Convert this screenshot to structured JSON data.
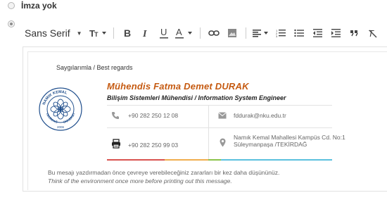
{
  "options": {
    "none_label": "İmza yok"
  },
  "toolbar": {
    "font_family": "Sans Serif"
  },
  "signature": {
    "greeting": "Saygılarımla / Best regards",
    "name": "Mühendis Fatma Demet DURAK",
    "title": "Bilişim Sistemleri Mühendisi / Information System Engineer",
    "phone": "+90 282 250 12 08",
    "fax": "+90 282 250 99 03",
    "email": "fddurak@nku.edu.tr",
    "address_line1": "Namık Kemal Mahallesi Kampüs Cd. No:1",
    "address_line2": "Süleymanpaşa /TEKİRDAĞ",
    "note_tr": "Bu mesajı yazdırmadan önce çevreye verebileceğiniz zararları bir kez daha düşününüz.",
    "note_en": "Think of the environment once more before printing out this message.",
    "logo_text_top": "NAMIK KEMAL",
    "logo_text_left": "TEKİRDAĞ",
    "logo_text_right": "ÜNİVERSİTESİ",
    "logo_year": "2006"
  },
  "colors": {
    "name_color": "#c55a11",
    "bar_red": "#d9534f",
    "bar_orange": "#f0ad4e",
    "bar_green": "#8bc34a",
    "bar_blue": "#5bc0de",
    "logo_blue": "#1f4e8c"
  }
}
